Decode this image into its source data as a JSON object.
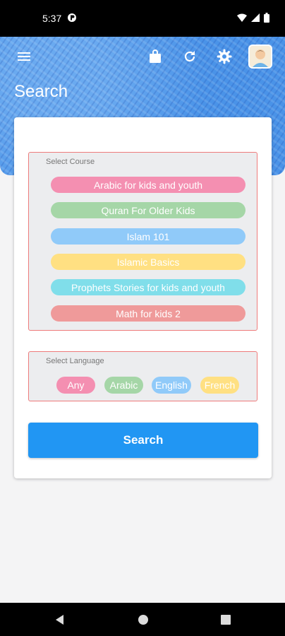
{
  "status_bar": {
    "time": "5:37"
  },
  "header": {
    "title": "Search"
  },
  "course_section": {
    "label": "Select Course",
    "courses": [
      {
        "label": "Arabic for kids and youth",
        "color": "#f48fb1"
      },
      {
        "label": "Quran For Older Kids",
        "color": "#a5d6a7"
      },
      {
        "label": "Islam 101",
        "color": "#90caf9"
      },
      {
        "label": "Islamic Basics",
        "color": "#ffe082"
      },
      {
        "label": "Prophets Stories for kids and youth",
        "color": "#80deea"
      },
      {
        "label": "Math for kids 2",
        "color": "#ef9a9a"
      }
    ]
  },
  "language_section": {
    "label": "Select Language",
    "languages": [
      {
        "label": "Any",
        "color": "#f48fb1"
      },
      {
        "label": "Arabic",
        "color": "#a5d6a7"
      },
      {
        "label": "English",
        "color": "#90caf9"
      },
      {
        "label": "French",
        "color": "#ffe082"
      }
    ]
  },
  "search_button": {
    "label": "Search",
    "color": "#2196f3"
  },
  "icons": {
    "toolbar": [
      "menu-icon",
      "shopping-bag-icon",
      "refresh-icon",
      "settings-icon",
      "avatar"
    ],
    "navigation": [
      "back-icon",
      "home-icon",
      "recents-icon"
    ]
  },
  "colors": {
    "header_blue": "#4a93e8",
    "border_red": "#ee7b7b"
  }
}
